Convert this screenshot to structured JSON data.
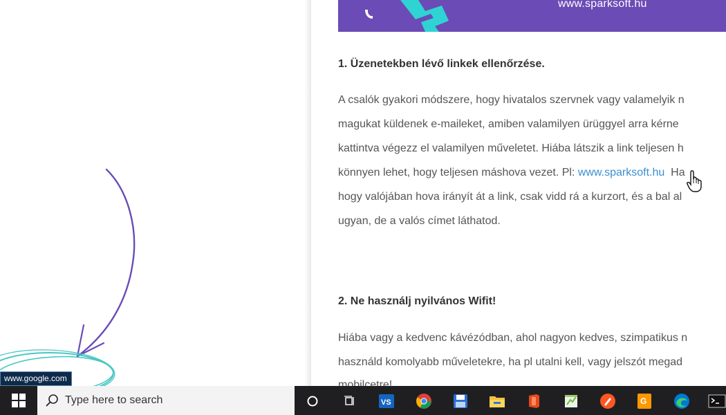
{
  "banner": {
    "url": "www.sparksoft.hu",
    "color": "#6b4bb5",
    "accent": "#2fd3d3"
  },
  "article": {
    "section1": {
      "heading": "1. Üzenetekben lévő linkek ellenőrzése.",
      "lines": [
        "A csalók gyakori módszere, hogy hivatalos szervnek vagy valamelyik n",
        "magukat küldenek e-maileket, amiben valamilyen ürüggyel arra kérne",
        "kattintva végezz el valamilyen műveletet. Hiába látszik a link teljesen h",
        {
          "before": "könnyen lehet, hogy teljesen máshova vezet. Pl: ",
          "link": "www.sparksoft.hu",
          "after": "  Ha"
        },
        "hogy valójában hova irányít át a link, csak vidd rá a kurzort, és a bal al",
        "ugyan, de a valós címet láthatod."
      ]
    },
    "section2": {
      "heading": "2. Ne használj nyilvános Wifit!",
      "lines": [
        "Hiába vagy a kedvenc kávézódban, ahol nagyon kedves, szimpatikus n",
        "használd komolyabb műveletekre, ha pl utalni kell, vagy jelszót megad",
        "mobilcetre!"
      ]
    }
  },
  "status_bar": {
    "url": "www.google.com"
  },
  "taskbar": {
    "search_placeholder": "Type here to search",
    "icons": [
      "cortana-icon",
      "task-view-icon",
      "vscode-icon",
      "chrome-icon",
      "save-app-icon",
      "file-explorer-icon",
      "office-icon",
      "notepad-plus-icon",
      "pen-app-icon",
      "pdf-app-icon",
      "edge-icon",
      "terminal-icon"
    ]
  }
}
